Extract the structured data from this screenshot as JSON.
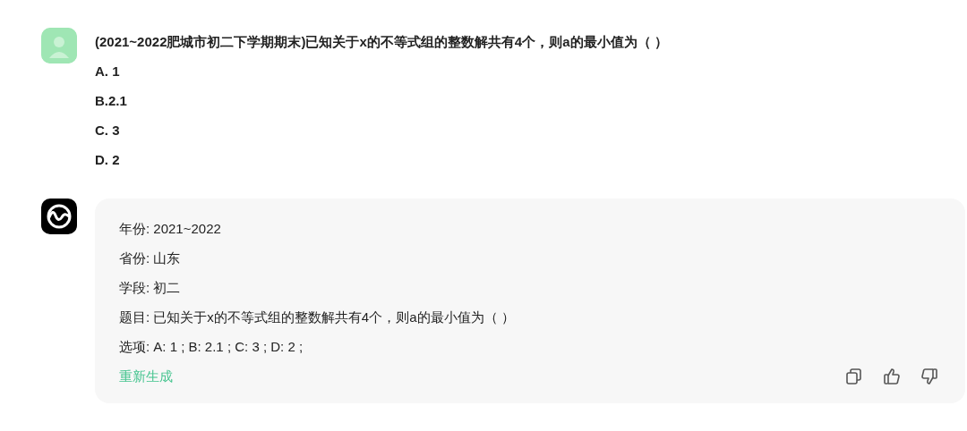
{
  "user_message": {
    "question": "(2021~2022肥城市初二下学期期末)已知关于x的不等式组的整数解共有4个，则a的最小值为（ ）",
    "options": [
      "A. 1",
      "B.2.1",
      "C. 3",
      "D. 2"
    ]
  },
  "bot_message": {
    "lines": [
      "年份: 2021~2022",
      "省份: 山东",
      "学段: 初二",
      "题目: 已知关于x的不等式组的整数解共有4个，则a的最小值为（ ）",
      "选项: A: 1 ; B: 2.1 ; C: 3 ; D: 2 ;"
    ],
    "regenerate": "重新生成"
  }
}
